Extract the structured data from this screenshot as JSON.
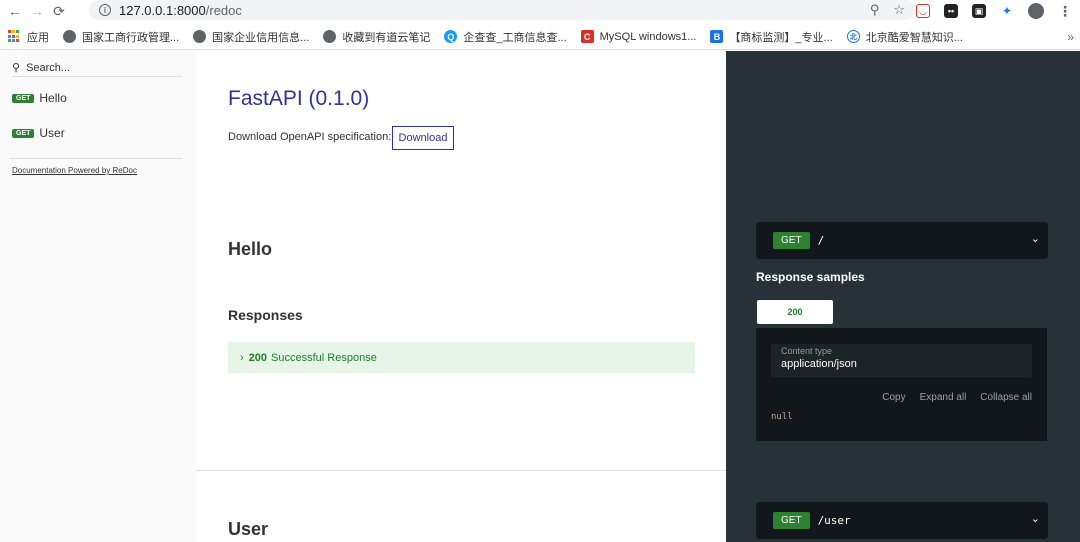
{
  "browser": {
    "url_host": "127.0.0.1:8000",
    "url_path": "/redoc",
    "bookmarks": [
      {
        "label": "应用",
        "icon": "apps-grid-icon"
      },
      {
        "label": "国家工商行政管理...",
        "icon": "globe-icon"
      },
      {
        "label": "国家企业信用信息...",
        "icon": "globe-icon"
      },
      {
        "label": "收藏到有道云笔记",
        "icon": "globe-icon"
      },
      {
        "label": "企查查_工商信息查...",
        "icon": "qichacha-icon"
      },
      {
        "label": "MySQL windows1...",
        "icon": "mysql-icon"
      },
      {
        "label": "【商标监测】_专业...",
        "icon": "trademark-icon"
      },
      {
        "label": "北京酷爱智慧知识...",
        "icon": "beijing-icon"
      }
    ],
    "more": "»"
  },
  "sidebar": {
    "search_placeholder": "Search...",
    "items": [
      {
        "method": "GET",
        "label": "Hello"
      },
      {
        "method": "GET",
        "label": "User"
      }
    ],
    "powered_by": "Documentation Powered by ReDoc"
  },
  "main": {
    "title": "FastAPI (0.1.0)",
    "download_label": "Download OpenAPI specification:",
    "download_button": "Download",
    "sections": [
      {
        "title": "Hello",
        "responses_label": "Responses",
        "response_code": "200",
        "response_text": "Successful Response"
      },
      {
        "title": "User"
      }
    ]
  },
  "right_panel": {
    "operations": [
      {
        "method": "GET",
        "path": "/"
      },
      {
        "method": "GET",
        "path": "/user"
      }
    ],
    "samples_title": "Response samples",
    "status_tab": "200",
    "content_type_label": "Content type",
    "content_type_value": "application/json",
    "actions": [
      "Copy",
      "Expand all",
      "Collapse all"
    ],
    "body": "null"
  },
  "colors": {
    "accent": "#32329f",
    "get_green": "#2f8132",
    "right_bg": "#263238",
    "success_bg": "#e7f5e8"
  }
}
